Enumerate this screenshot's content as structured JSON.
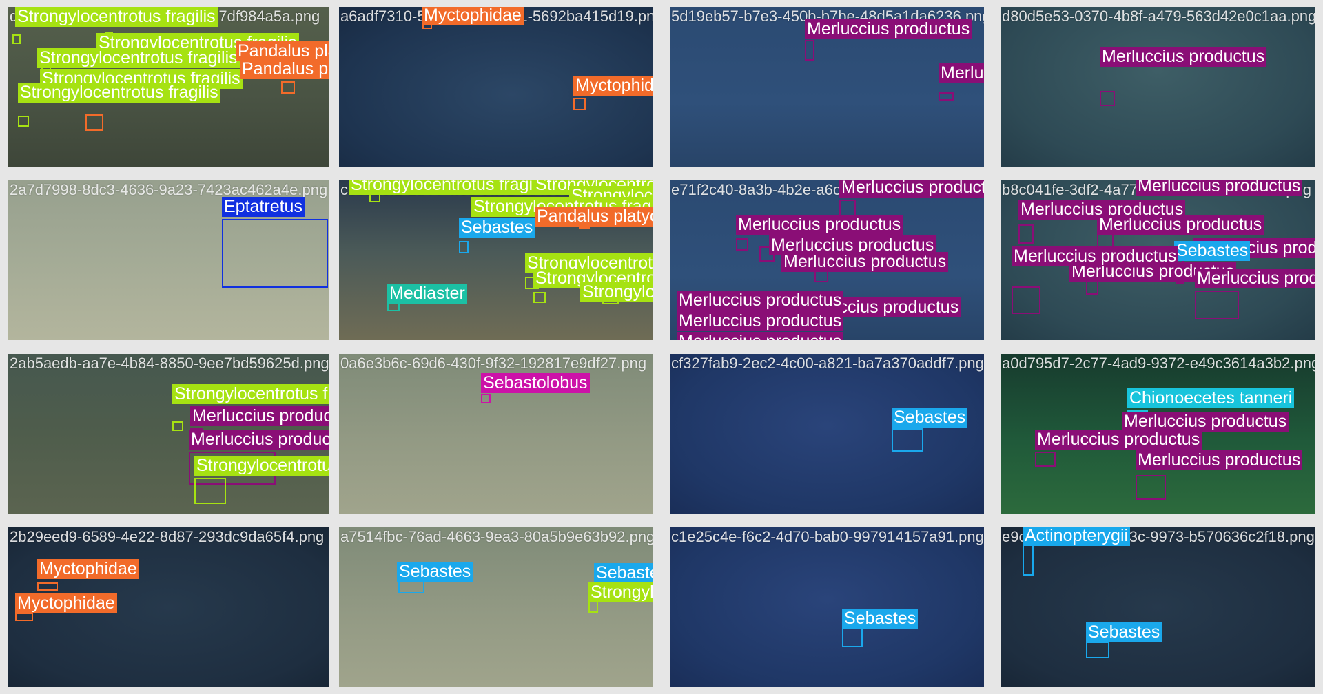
{
  "colors": {
    "Strongylocentrotus fragilis": "#a6e212",
    "Myctophidae": "#f26b2a",
    "Pandalus platyceros": "#f26b2a",
    "Merluccius productus": "#8a0e76",
    "Eptatretus": "#1030e0",
    "Sebastes": "#1aa8ec",
    "Mediaster": "#1cc0a4",
    "Sebastolobus": "#cc12a8",
    "Chionoecetes tanneri": "#18c4dc",
    "Actinopterygii": "#18a8ec"
  },
  "tiles": [
    {
      "filename": "d0e6de17-6d9a-4bc0-82b6-f077df984a5a.png",
      "scene": "seafloor-olive",
      "labels": [
        "Strongylocentrotus fragilis",
        "Strongylocentrotus fragilis",
        "Strongylocentrotus fragilis",
        "Strongylocentrotus fragilis",
        "Strongylocentrotus fragilis",
        "Pandalus platyceros",
        "Pandalus platyceros"
      ]
    },
    {
      "filename": "a6adf7310-5b7b-4c01-b571-5692ba415d19.png",
      "scene": "midwater-squid",
      "labels": [
        "Myctophidae",
        "Myctophidae"
      ]
    },
    {
      "filename": "5d19eb57-b7e3-450b-b7be-48d5a1da6236.png",
      "scene": "midwater-blue",
      "labels": [
        "Merluccius productus",
        "Merluccius productus"
      ]
    },
    {
      "filename": "d80d5e53-0370-4b8f-a479-563d42e0c1aa.png",
      "scene": "midwater-teal",
      "labels": [
        "Merluccius productus"
      ]
    },
    {
      "filename": "2a7d7998-8dc3-4636-9a23-7423ac462a4e.png",
      "scene": "seafloor-murky",
      "labels": [
        "Eptatretus"
      ]
    },
    {
      "filename": "c3b9a8f2-1d44-4f0e-9a61-3848960c0c29.png",
      "scene": "seafloor-equipment",
      "labels": [
        "Strongylocentrotus fragilis",
        "Strongylocentrotus fragilis",
        "Strongylocentrotus fragilis",
        "Strongylocentrotus fragilis",
        "Pandalus platyceros",
        "Sebastes",
        "Mediaster",
        "Strongylocentrotus fragilis",
        "Strongylocentrotus fragilis",
        "Strongylocentrotus fragilis"
      ]
    },
    {
      "filename": "e71f2c40-8a3b-4b2e-a6c2-a56525fa1a0b.png",
      "scene": "midwater-blue",
      "labels": [
        "Merluccius productus",
        "Merluccius productus",
        "Merluccius productus",
        "Merluccius productus",
        "Merluccius productus",
        "Merluccius productus",
        "Merluccius productus",
        "Merluccius productus"
      ]
    },
    {
      "filename": "b8c041fe-3df2-4a77-91e0-31c5ad9490e0.png",
      "scene": "midwater-teal",
      "labels": [
        "Merluccius productus",
        "Merluccius productus",
        "Merluccius productus",
        "Merluccius productus",
        "Merluccius productus",
        "Sebastes",
        "Merluccius productus",
        "Merluccius productus"
      ]
    },
    {
      "filename": "2ab5aedb-aa7e-4b84-8850-9ee7bd59625d.png",
      "scene": "seafloor-urchins",
      "labels": [
        "Strongylocentrotus fragilis",
        "Merluccius productus",
        "Merluccius productus",
        "Strongylocentrotus fragilis"
      ]
    },
    {
      "filename": "0a6e3b6c-69d6-430f-9f32-192817e9df27.png",
      "scene": "seafloor-haze",
      "labels": [
        "Sebastolobus"
      ]
    },
    {
      "filename": "cf327fab9-2ec2-4c00-a821-ba7a370addf7.png",
      "scene": "midwater-deepblue",
      "labels": [
        "Sebastes"
      ]
    },
    {
      "filename": "a0d795d7-2c77-4ad9-9372-e49c3614a3b2.png",
      "scene": "seafloor-green",
      "labels": [
        "Chionoecetes tanneri",
        "Merluccius productus",
        "Merluccius productus",
        "Merluccius productus"
      ]
    },
    {
      "filename": "2b29eed9-6589-4e22-8d87-293dc9da65f4.png",
      "scene": "midwater-dark",
      "labels": [
        "Myctophidae",
        "Myctophidae"
      ]
    },
    {
      "filename": "a7514fbc-76ad-4663-9ea3-80a5b9e63b92.png",
      "scene": "seafloor-haze",
      "labels": [
        "Sebastes",
        "Sebastes",
        "Strongylocentrotus fragilis"
      ]
    },
    {
      "filename": "c1e25c4e-f6c2-4d70-bab0-997914157a91.png",
      "scene": "midwater-deepblue",
      "labels": [
        "Sebastes"
      ]
    },
    {
      "filename": "e9c4d0aa-1b2e-403c-9973-b570636c2f18.png",
      "scene": "midwater-dark",
      "labels": [
        "Actinopterygii",
        "Sebastes"
      ]
    }
  ]
}
